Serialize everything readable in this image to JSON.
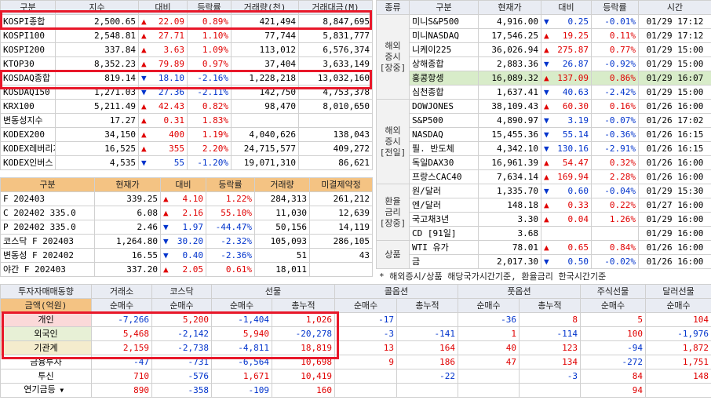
{
  "colors": {
    "up": "#e00000",
    "down": "#0033cc",
    "highlight": "#e8182a",
    "header_orange": "#f4c383"
  },
  "domestic": {
    "headers": [
      "구분",
      "지수",
      "대비",
      "등락률",
      "거래량(천)",
      "거래대금(M)"
    ],
    "rows": [
      {
        "name": "KOSPI종합",
        "value": "2,500.65",
        "dir": "up",
        "change": "22.09",
        "rate": "0.89%",
        "volume": "421,494",
        "amount": "8,847,695"
      },
      {
        "name": "KOSPI100",
        "value": "2,548.81",
        "dir": "up",
        "change": "27.71",
        "rate": "1.10%",
        "volume": "77,744",
        "amount": "5,831,777"
      },
      {
        "name": "KOSPI200",
        "value": "337.84",
        "dir": "up",
        "change": "3.63",
        "rate": "1.09%",
        "volume": "113,012",
        "amount": "6,576,374"
      },
      {
        "name": "KTOP30",
        "value": "8,352.23",
        "dir": "up",
        "change": "79.89",
        "rate": "0.97%",
        "volume": "37,404",
        "amount": "3,633,149"
      },
      {
        "name": "KOSDAQ종합",
        "value": "819.14",
        "dir": "dn",
        "change": "18.10",
        "rate": "-2.16%",
        "volume": "1,228,218",
        "amount": "13,032,160"
      },
      {
        "name": "KOSDAQ150",
        "value": "1,271.03",
        "dir": "dn",
        "change": "27.36",
        "rate": "-2.11%",
        "volume": "142,750",
        "amount": "4,753,378"
      },
      {
        "name": "KRX100",
        "value": "5,211.49",
        "dir": "up",
        "change": "42.43",
        "rate": "0.82%",
        "volume": "98,470",
        "amount": "8,010,650"
      },
      {
        "name": "변동성지수",
        "value": "17.27",
        "dir": "up",
        "change": "0.31",
        "rate": "1.83%",
        "volume": "",
        "amount": ""
      },
      {
        "name": "KODEX200",
        "value": "34,150",
        "dir": "up",
        "change": "400",
        "rate": "1.19%",
        "volume": "4,040,626",
        "amount": "138,043"
      },
      {
        "name": "KODEX레버리지",
        "value": "16,525",
        "dir": "up",
        "change": "355",
        "rate": "2.20%",
        "volume": "24,715,577",
        "amount": "409,272"
      },
      {
        "name": "KODEX인버스",
        "value": "4,535",
        "dir": "dn",
        "change": "55",
        "rate": "-1.20%",
        "volume": "19,071,310",
        "amount": "86,621"
      }
    ]
  },
  "derivatives": {
    "headers": [
      "구분",
      "현재가",
      "대비",
      "등락률",
      "거래량",
      "미결제약정"
    ],
    "rows": [
      {
        "name": "F 202403",
        "value": "339.25",
        "dir": "up",
        "change": "4.10",
        "rate": "1.22%",
        "volume": "284,313",
        "oi": "261,212"
      },
      {
        "name": "C 202402 335.0",
        "value": "6.08",
        "dir": "up",
        "change": "2.16",
        "rate": "55.10%",
        "volume": "11,030",
        "oi": "12,639"
      },
      {
        "name": "P 202402 335.0",
        "value": "2.46",
        "dir": "dn",
        "change": "1.97",
        "rate": "-44.47%",
        "volume": "50,156",
        "oi": "14,119"
      },
      {
        "name": "코스닥 F 202403",
        "value": "1,264.80",
        "dir": "dn",
        "change": "30.20",
        "rate": "-2.32%",
        "volume": "105,093",
        "oi": "286,105"
      },
      {
        "name": "변동성 F 202402",
        "value": "16.55",
        "dir": "dn",
        "change": "0.40",
        "rate": "-2.36%",
        "volume": "51",
        "oi": "43"
      },
      {
        "name": "야간 F 202403",
        "value": "337.20",
        "dir": "up",
        "change": "2.05",
        "rate": "0.61%",
        "volume": "18,011",
        "oi": ""
      }
    ]
  },
  "world": {
    "headers": [
      "종류",
      "구분",
      "현재가",
      "대비",
      "등락률",
      "시간"
    ],
    "groups": [
      {
        "label": "해외\n증시\n[장중]",
        "span": 6,
        "rows": [
          {
            "name": "미니S&P500",
            "value": "4,916.00",
            "dir": "dn",
            "change": "0.25",
            "rate": "-0.01%",
            "time": "01/29 17:12"
          },
          {
            "name": "미니NASDAQ",
            "value": "17,546.25",
            "dir": "up",
            "change": "19.25",
            "rate": "0.11%",
            "time": "01/29 17:12"
          },
          {
            "name": "니케이225",
            "value": "36,026.94",
            "dir": "up",
            "change": "275.87",
            "rate": "0.77%",
            "time": "01/29 15:00"
          },
          {
            "name": "상해종합",
            "value": "2,883.36",
            "dir": "dn",
            "change": "26.87",
            "rate": "-0.92%",
            "time": "01/29 15:00"
          },
          {
            "name": "홍콩항셍",
            "value": "16,089.32",
            "dir": "up",
            "change": "137.09",
            "rate": "0.86%",
            "time": "01/29 16:07"
          },
          {
            "name": "심천종합",
            "value": "1,637.41",
            "dir": "dn",
            "change": "40.63",
            "rate": "-2.42%",
            "time": "01/29 15:00"
          }
        ]
      },
      {
        "label": "해외\n증시\n[전일]",
        "span": 6,
        "rows": [
          {
            "name": "DOWJONES",
            "value": "38,109.43",
            "dir": "up",
            "change": "60.30",
            "rate": "0.16%",
            "time": "01/26 16:00"
          },
          {
            "name": "S&P500",
            "value": "4,890.97",
            "dir": "dn",
            "change": "3.19",
            "rate": "-0.07%",
            "time": "01/26 17:02"
          },
          {
            "name": "NASDAQ",
            "value": "15,455.36",
            "dir": "dn",
            "change": "55.14",
            "rate": "-0.36%",
            "time": "01/26 16:15"
          },
          {
            "name": "필. 반도체",
            "value": "4,342.10",
            "dir": "dn",
            "change": "130.16",
            "rate": "-2.91%",
            "time": "01/26 16:15"
          },
          {
            "name": "독일DAX30",
            "value": "16,961.39",
            "dir": "up",
            "change": "54.47",
            "rate": "0.32%",
            "time": "01/26 16:00"
          },
          {
            "name": "프랑스CAC40",
            "value": "7,634.14",
            "dir": "up",
            "change": "169.94",
            "rate": "2.28%",
            "time": "01/26 16:00"
          }
        ]
      },
      {
        "label": "환율\n금리\n[장중]",
        "span": 4,
        "rows": [
          {
            "name": "원/달러",
            "value": "1,335.70",
            "dir": "dn",
            "change": "0.60",
            "rate": "-0.04%",
            "time": "01/29 15:30"
          },
          {
            "name": "엔/달러",
            "value": "148.18",
            "dir": "up",
            "change": "0.33",
            "rate": "0.22%",
            "time": "01/27 16:00"
          },
          {
            "name": "국고채3년",
            "value": "3.30",
            "dir": "up",
            "change": "0.04",
            "rate": "1.26%",
            "time": "01/29 16:00"
          },
          {
            "name": "CD [91일]",
            "value": "3.68",
            "dir": "",
            "change": "",
            "rate": "",
            "time": "01/29 16:00"
          }
        ]
      },
      {
        "label": "상품",
        "span": 2,
        "rows": [
          {
            "name": "WTI 유가",
            "value": "78.01",
            "dir": "up",
            "change": "0.65",
            "rate": "0.84%",
            "time": "01/26 16:00"
          },
          {
            "name": "금",
            "value": "2,017.30",
            "dir": "dn",
            "change": "0.50",
            "rate": "-0.02%",
            "time": "01/26 16:00"
          }
        ]
      }
    ],
    "note": "* 해외증시/상품 해당국가시간기준, 환율금리 한국시간기준"
  },
  "investor": {
    "title": "투자자매매동향",
    "unit": "금액(억원)",
    "col_groups": [
      "거래소",
      "코스닥",
      "선물",
      "콜옵션",
      "풋옵션",
      "주식선물",
      "달러선물"
    ],
    "sub_headers": [
      "순매수",
      "순매수",
      "순매수",
      "총누적",
      "순매수",
      "총누적",
      "순매수",
      "총누적",
      "순매수",
      "순매수"
    ],
    "rows": [
      {
        "name": "개인",
        "vals": [
          "-7,266",
          "5,200",
          "-1,404",
          "1,026",
          "-17",
          "",
          "-36",
          "8",
          "5",
          "104"
        ]
      },
      {
        "name": "외국인",
        "vals": [
          "5,468",
          "-2,142",
          "5,940",
          "-20,278",
          "-3",
          "-141",
          "1",
          "-114",
          "100",
          "-1,976"
        ]
      },
      {
        "name": "기관계",
        "vals": [
          "2,159",
          "-2,738",
          "-4,811",
          "18,819",
          "13",
          "164",
          "40",
          "123",
          "-94",
          "1,872"
        ]
      },
      {
        "name": "금융투자",
        "vals": [
          "-47",
          "-731",
          "-6,564",
          "10,698",
          "9",
          "186",
          "47",
          "134",
          "-272",
          "1,751"
        ]
      },
      {
        "name": "투신",
        "vals": [
          "710",
          "-576",
          "1,671",
          "10,419",
          "",
          "-22",
          "",
          "-3",
          "84",
          "148"
        ]
      },
      {
        "name": "연기금등",
        "vals": [
          "890",
          "-358",
          "-109",
          "160",
          "",
          "",
          "",
          "",
          "94",
          ""
        ]
      }
    ]
  }
}
